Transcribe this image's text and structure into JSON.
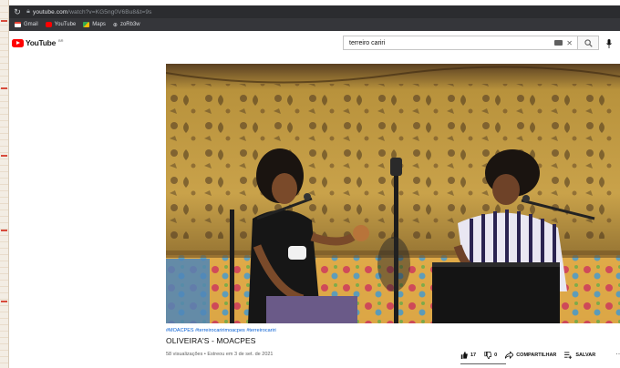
{
  "browser": {
    "url_host": "youtube.com",
    "url_path": "/watch?v=KG5ng0V6Bu8&t=9s",
    "bookmarks": [
      {
        "label": "Gmail",
        "color": "#ea4335"
      },
      {
        "label": "YouTube",
        "color": "#ff0000"
      },
      {
        "label": "Maps",
        "color": "#34a853"
      },
      {
        "label": "zoRb3w",
        "color": "#dadce0"
      }
    ]
  },
  "masthead": {
    "logo_text": "YouTube",
    "logo_region": "BR",
    "search_query": "terreiro cariri"
  },
  "video": {
    "hashtags": "#MOACPES #terreirocaririmoacpes #terreirocariri",
    "title": "OLIVEIRA'S - MOACPES",
    "stats": "58 visualizações • Estreou em 3 de set. de 2021",
    "likes": "17",
    "dislikes": "0",
    "share_label": "COMPARTILHAR",
    "save_label": "SALVAR"
  },
  "colors": {
    "brand_red": "#ff0000",
    "link_blue": "#065fd4",
    "chrome_dark": "#2b2c2f"
  }
}
